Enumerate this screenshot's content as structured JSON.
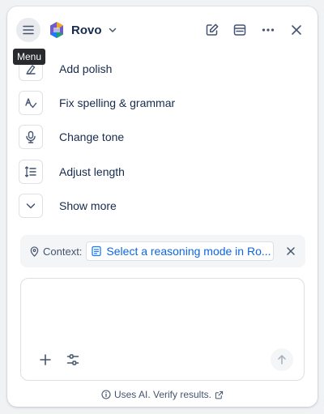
{
  "header": {
    "brand_name": "Rovo",
    "menu_tooltip": "Menu",
    "icons": [
      "menu-icon",
      "rovo-logo-icon",
      "chevron-down-icon",
      "edit-icon",
      "sidebar-panel-icon",
      "more-icon",
      "close-icon"
    ]
  },
  "actions": [
    {
      "label": "Add polish",
      "icon": "polish-icon"
    },
    {
      "label": "Fix spelling & grammar",
      "icon": "spelling-icon"
    },
    {
      "label": "Change tone",
      "icon": "microphone-icon"
    },
    {
      "label": "Adjust length",
      "icon": "adjust-length-icon"
    },
    {
      "label": "Show more",
      "icon": "chevron-down-icon"
    }
  ],
  "context": {
    "label": "Context:",
    "chip_text": "Select a reasoning mode in Ro..."
  },
  "composer": {
    "value": ""
  },
  "footer": {
    "text": "Uses AI. Verify results."
  },
  "colors": {
    "link": "#0c66e4",
    "text": "#172b4d",
    "subtle": "#44546f",
    "tooltip_bg": "#292a2e"
  }
}
